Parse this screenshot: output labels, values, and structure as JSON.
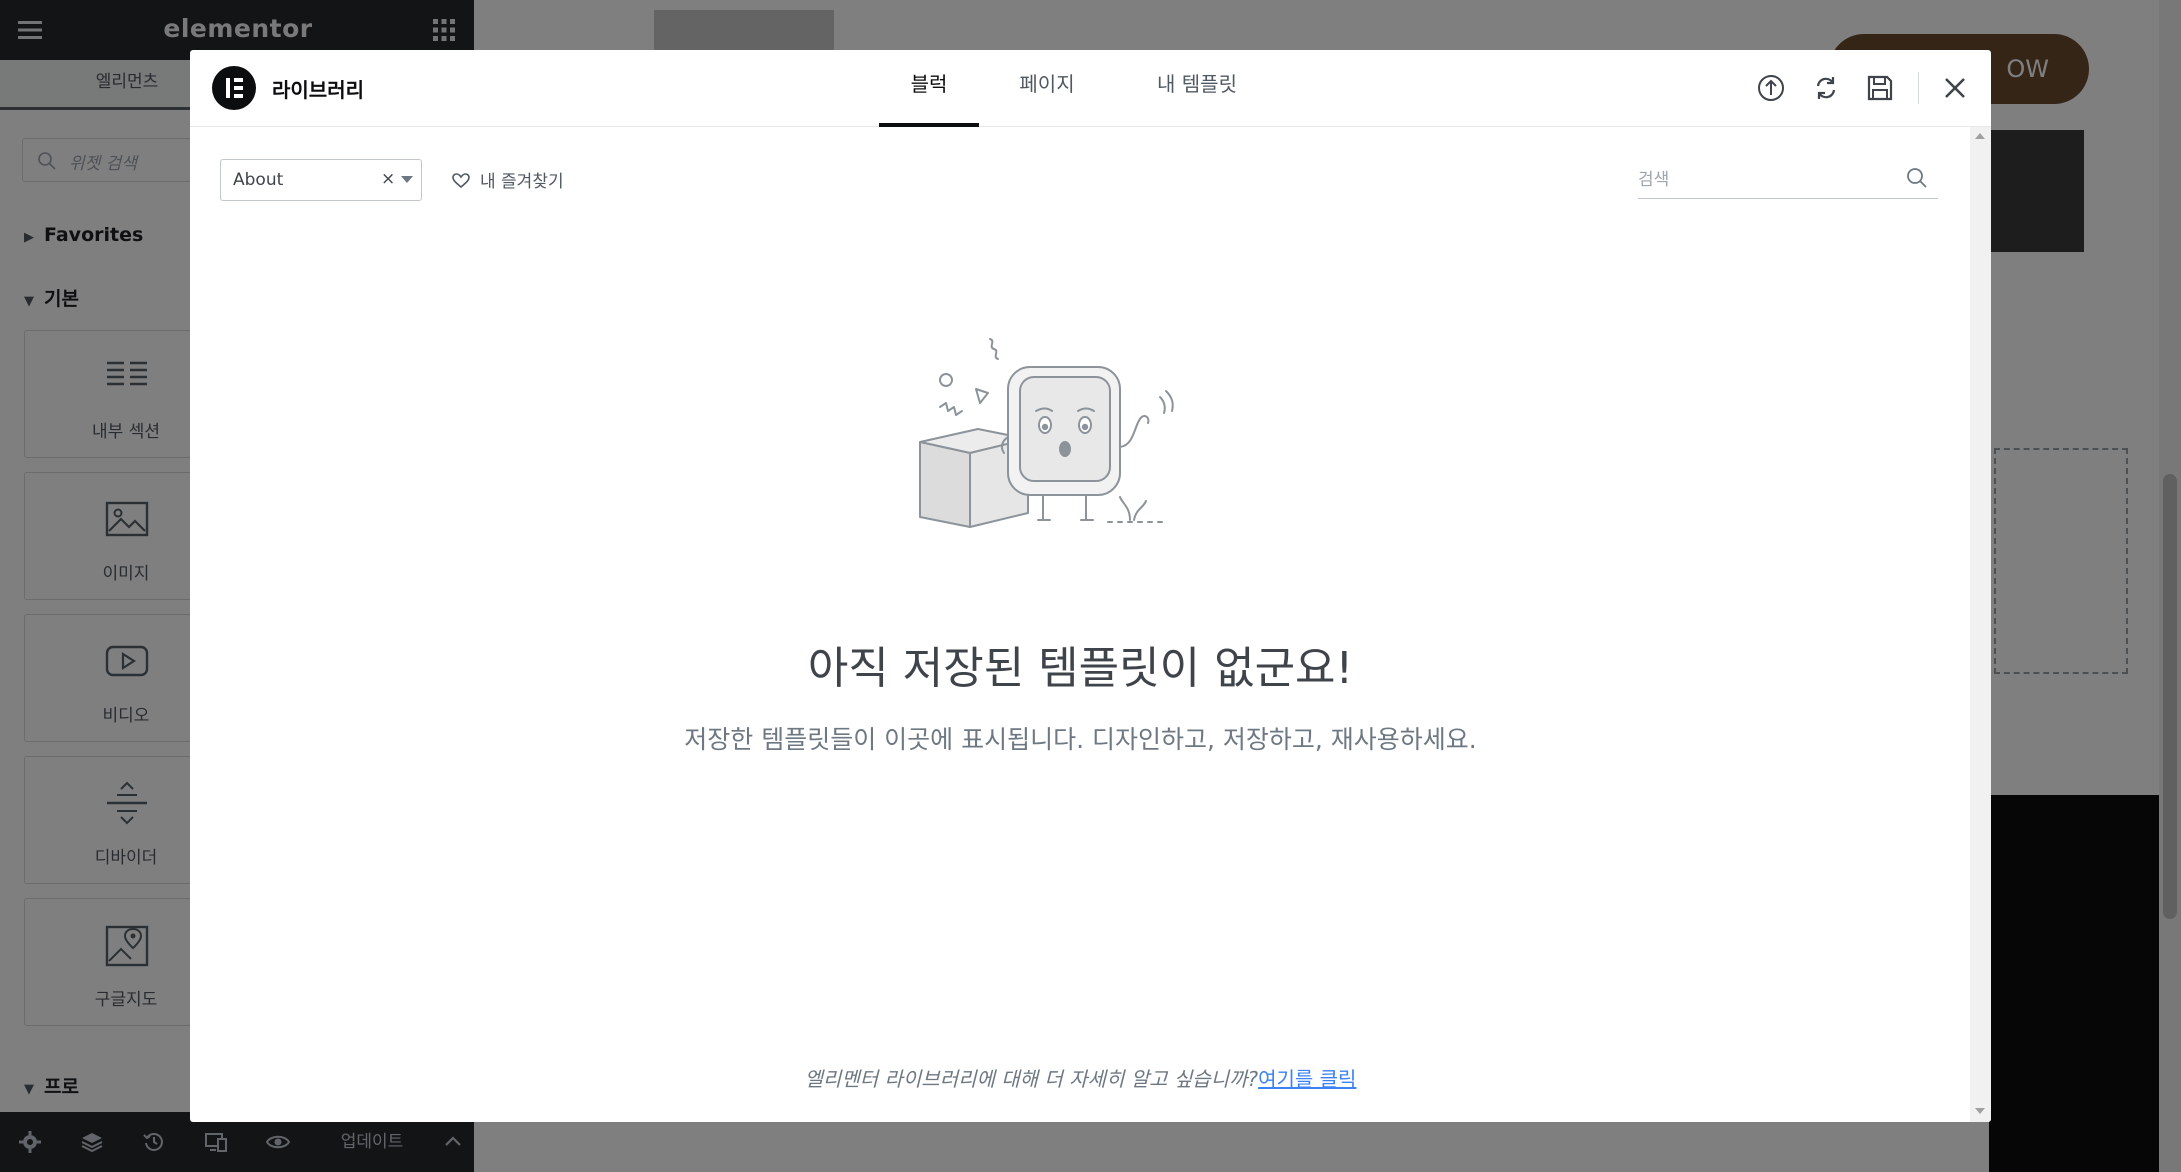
{
  "panel": {
    "logo": "elementor",
    "tab_elements": "엘리먼츠",
    "search_placeholder": "위젯 검색",
    "categories": {
      "favorites": "Favorites",
      "basic": "기본",
      "pro": "프로"
    },
    "widgets": [
      {
        "label": "내부 섹션",
        "icon": "inner-section-icon"
      },
      {
        "label": "이미지",
        "icon": "image-icon"
      },
      {
        "label": "비디오",
        "icon": "video-icon"
      },
      {
        "label": "디바이더",
        "icon": "divider-icon"
      },
      {
        "label": "구글지도",
        "icon": "google-maps-icon"
      }
    ],
    "footer": {
      "update_label": "업데이트"
    }
  },
  "preview": {
    "button_label": "OW"
  },
  "modal": {
    "title": "라이브러리",
    "tabs": [
      {
        "label": "블럭",
        "active": true
      },
      {
        "label": "페이지",
        "active": false
      },
      {
        "label": "내 템플릿",
        "active": false
      }
    ],
    "filter": {
      "selected": "About",
      "clear": "×"
    },
    "favorites_label": "내 즐겨찾기",
    "search_placeholder": "검색",
    "empty": {
      "title": "아직 저장된 템플릿이 없군요!",
      "message": "저장한 템플릿들이 이곳에 표시됩니다. 디자인하고, 저장하고, 재사용하세요.",
      "learn_more": "엘리멘터 라이브러리에 대해 더 자세히 알고 싶습니까?",
      "link": "여기를 클릭"
    }
  },
  "colors": {
    "panel_dark": "#26292c",
    "overlay": "rgba(0,0,0,0.5)",
    "link": "#3b82f6",
    "accent_brown": "#6b4a2f"
  }
}
